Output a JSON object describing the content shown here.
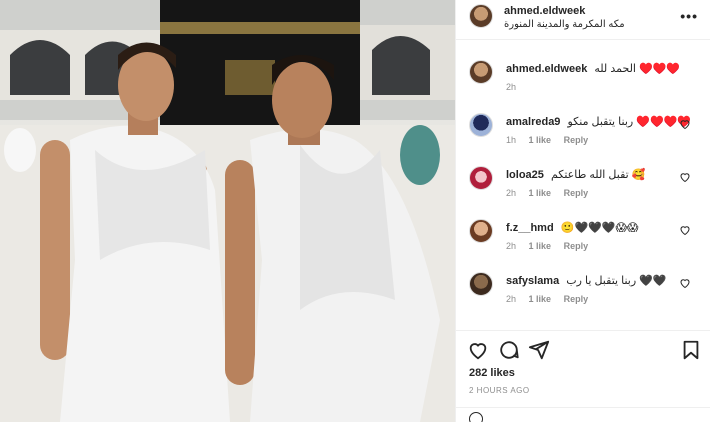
{
  "post": {
    "username": "ahmed.eldweek",
    "location": "مكه المكرمة والمدينة المنورة",
    "more_icon": "more-dots-icon",
    "caption_text": "الحمد لله ♥️♥️♥️",
    "caption_time": "2h"
  },
  "comments": [
    {
      "user": "amalreda9",
      "text": "ربنا يتقبل منكو ♥️♥️♥️♥️",
      "time": "1h",
      "likes": "1 like",
      "reply": "Reply"
    },
    {
      "user": "loloa25",
      "text": "تقبل الله طاعتكم 🥰",
      "time": "2h",
      "likes": "1 like",
      "reply": "Reply"
    },
    {
      "user": "f.z__hmd",
      "text": "🙂🖤🖤🖤😱😱",
      "time": "2h",
      "likes": "1 like",
      "reply": "Reply"
    },
    {
      "user": "safyslama",
      "text": "ربنا يتقبل يا رب 🖤🖤",
      "time": "2h",
      "likes": "1 like",
      "reply": "Reply"
    }
  ],
  "actions": {
    "likes": "282 likes",
    "posted_ago": "2 HOURS AGO"
  },
  "colors": {
    "heart": "#ed4956",
    "meta": "#8e8e8e",
    "text": "#262626"
  }
}
